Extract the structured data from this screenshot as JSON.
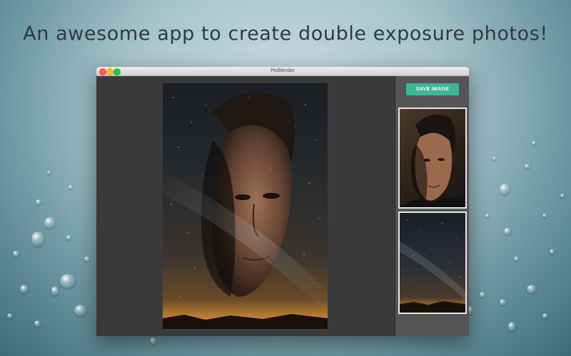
{
  "headline": "An awesome app to create double exposure photos!",
  "window": {
    "title": "PicBlender",
    "controls": [
      "close",
      "minimize",
      "zoom"
    ]
  },
  "sidebar": {
    "save_label": "SAVE IMAGE",
    "thumbnails": [
      "portrait-photo",
      "starry-sky-photo"
    ]
  },
  "colors": {
    "accent": "#40b596",
    "canvas_bg": "#3a3a3a",
    "sidebar_bg": "#555555"
  },
  "icons": [
    "close-icon",
    "minimize-icon",
    "zoom-icon"
  ]
}
